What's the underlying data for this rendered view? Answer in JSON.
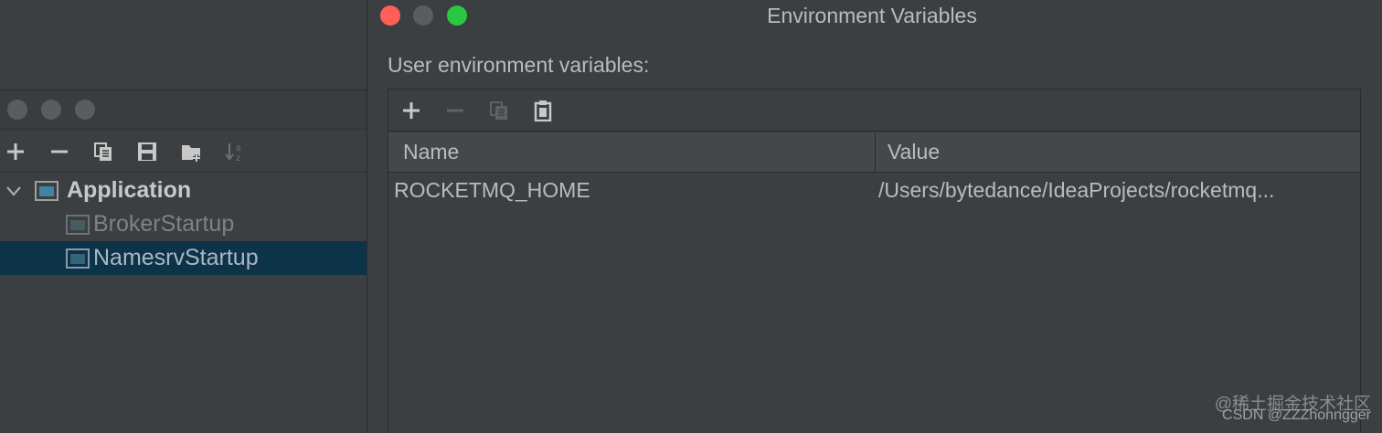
{
  "background_window": {
    "toolbar": {
      "add": "plus-icon",
      "remove": "minus-icon",
      "copy": "copy-icon",
      "save": "save-icon",
      "new_folder": "new-folder-icon",
      "sort": "sort-alpha-icon"
    },
    "tree": {
      "group_label": "Application",
      "items": [
        {
          "label": "BrokerStartup",
          "selected": false
        },
        {
          "label": "NamesrvStartup",
          "selected": true
        }
      ]
    }
  },
  "dialog": {
    "title": "Environment Variables",
    "section_label": "User environment variables:",
    "toolbar": {
      "add": "plus-icon",
      "remove": "minus-icon",
      "copy": "copy-icon",
      "paste": "paste-icon"
    },
    "table": {
      "headers": [
        "Name",
        "Value"
      ],
      "rows": [
        {
          "name": "ROCKETMQ_HOME",
          "value": "/Users/bytedance/IdeaProjects/rocketmq..."
        }
      ]
    }
  },
  "watermark": {
    "line1": "@稀土掘金技术社区",
    "line2": "CSDN @ZZZhonngger"
  },
  "colors": {
    "window_bg": "#3c3f41",
    "selection": "#0d3349",
    "close": "#ff5f57",
    "minimize": "#febc2e",
    "zoom": "#28c840",
    "text": "#bbbbbb"
  }
}
